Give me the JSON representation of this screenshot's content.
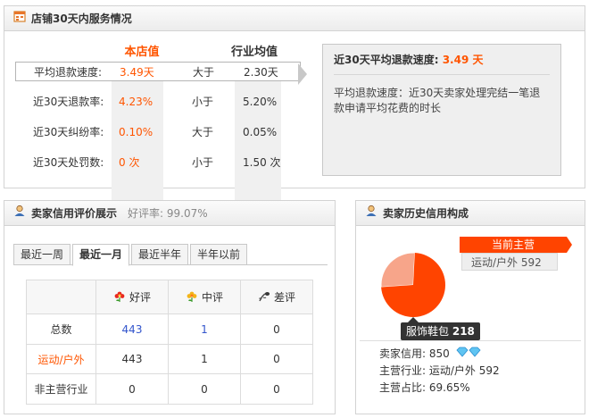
{
  "service_panel": {
    "title": "店铺30天内服务情况",
    "col_shop": "本店值",
    "col_industry": "行业均值",
    "rows": [
      {
        "label": "平均退款速度:",
        "shop": "3.49天",
        "compare": "大于",
        "industry": "2.30天"
      },
      {
        "label": "近30天退款率:",
        "shop": "4.23%",
        "compare": "小于",
        "industry": "5.20%"
      },
      {
        "label": "近30天纠纷率:",
        "shop": "0.10%",
        "compare": "大于",
        "industry": "0.05%"
      },
      {
        "label": "近30天处罚数:",
        "shop": "0 次",
        "compare": "小于",
        "industry": "1.50 次"
      }
    ],
    "detail": {
      "title_label": "近30天平均退款速度:",
      "title_value": "3.49 天",
      "text": "平均退款速度：近30天卖家处理完结一笔退款申请平均花费的时长"
    }
  },
  "rating_panel": {
    "title": "卖家信用评价展示",
    "positive_rate": "好评率: 99.07%",
    "tabs": [
      "最近一周",
      "最近一月",
      "最近半年",
      "半年以前"
    ],
    "active_tab": 1,
    "headers": {
      "good": "好评",
      "neutral": "中评",
      "bad": "差评"
    },
    "rows": [
      {
        "label": "总数",
        "good": "443",
        "neutral": "1",
        "bad": "0"
      },
      {
        "label": "运动/户外",
        "good": "443",
        "neutral": "1",
        "bad": "0"
      },
      {
        "label": "非主营行业",
        "good": "0",
        "neutral": "0",
        "bad": "0"
      }
    ]
  },
  "history_panel": {
    "title": "卖家历史信用构成",
    "main_tag": "当前主营",
    "main_sub": "运动/户外   592",
    "tooltip_label": "服饰鞋包",
    "tooltip_value": "218",
    "pie": {
      "main_share": 0.7308,
      "other_share": 0.2692,
      "main_color": "#ff4400",
      "other_color": "#f7a58a"
    },
    "credit_label": "卖家信用: 850",
    "industry_label": "主营行业: 运动/户外 592",
    "share_label": "主营占比: 69.65%"
  },
  "colors": {
    "accent": "#ff5500",
    "link": "#3355cc"
  }
}
